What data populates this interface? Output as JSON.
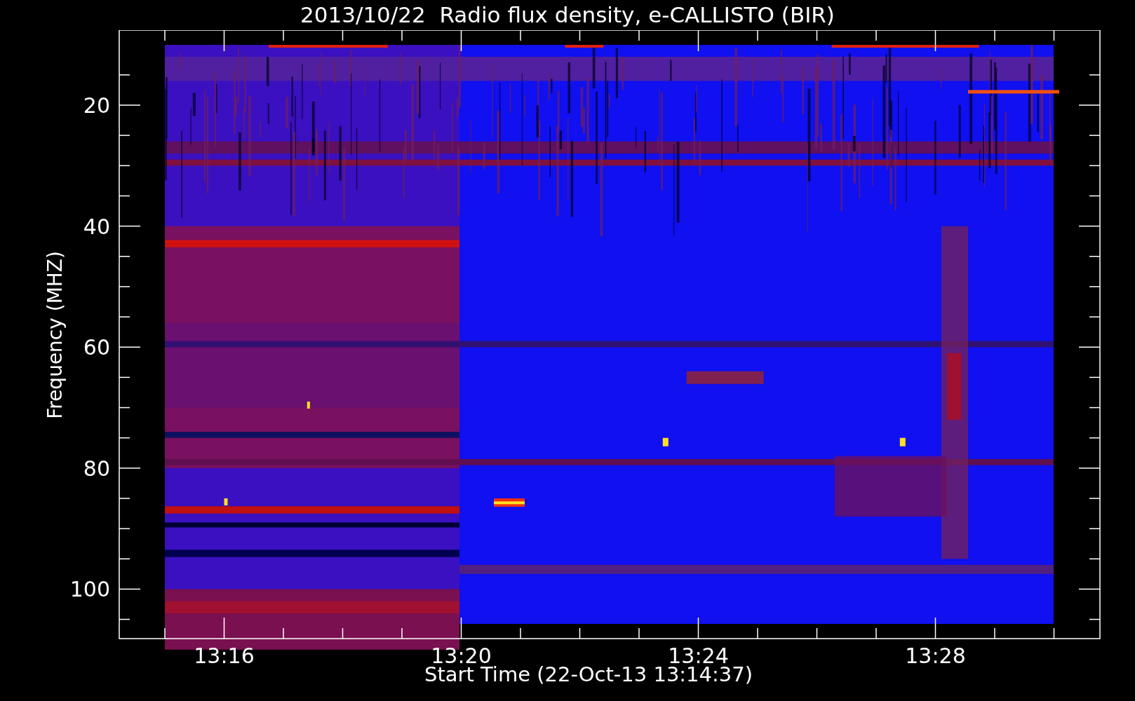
{
  "plot": {
    "title": "2013/10/22  Radio flux density, e-CALLISTO (BIR)",
    "ylabel": "Frequency (MHZ)",
    "xlabel": "Start Time (22-Oct-13 13:14:37)",
    "yticks": [
      "20",
      "40",
      "60",
      "80",
      "100"
    ],
    "xticks": [
      "13:16",
      "13:20",
      "13:24",
      "13:28"
    ]
  }
}
